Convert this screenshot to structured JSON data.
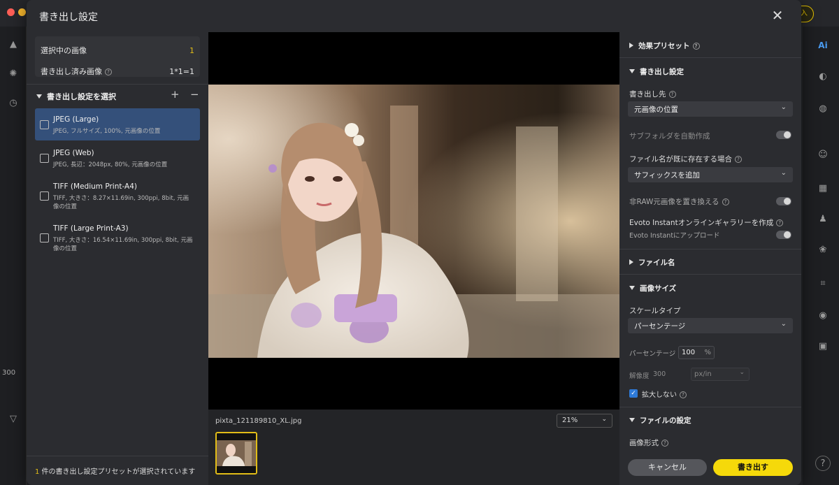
{
  "background": {
    "buy_label": "く購入",
    "left_count": "300",
    "app_logo": "Ai",
    "help": "?"
  },
  "dialog": {
    "title": "書き出し設定",
    "close": "✕"
  },
  "left": {
    "info": {
      "selected_label": "選択中の画像",
      "selected_value": "1",
      "exported_label": "書き出し済み画像",
      "exported_value": "1*1=1"
    },
    "section_title": "書き出し設定を選択",
    "add": "+",
    "remove": "−",
    "presets": [
      {
        "name": "JPEG (Large)",
        "desc": "JPEG, フルサイズ, 100%, 元画像の位置"
      },
      {
        "name": "JPEG (Web)",
        "desc": "JPEG, 長辺：2048px, 80%, 元画像の位置"
      },
      {
        "name": "TIFF (Medium Print-A4)",
        "desc": "TIFF, 大きさ：8.27×11.69in, 300ppi, 8bit, 元画像の位置"
      },
      {
        "name": "TIFF (Large Print-A3)",
        "desc": "TIFF, 大きさ：16.54×11.69in, 300ppi, 8bit, 元画像の位置"
      }
    ],
    "footer_count": "1",
    "footer_text": " 件の書き出し設定プリセットが選択されています"
  },
  "center": {
    "filename": "pixta_121189810_XL.jpg",
    "zoom": "21%"
  },
  "right": {
    "effect_preset": "効果プリセット",
    "export_settings": "書き出し設定",
    "destination_label": "書き出し先",
    "destination_value": "元画像の位置",
    "subfolder_label": "サブフォルダを自動作成",
    "exists_label": "ファイル名が既に存在する場合",
    "exists_value": "サフィックスを追加",
    "replace_raw_label": "非RAW元画像を置き換える",
    "evoto_gallery_label": "Evoto Instantオンラインギャラリーを作成",
    "evoto_upload_label": "Evoto Instantにアップロード",
    "filename_section": "ファイル名",
    "image_size_section": "画像サイズ",
    "scale_type_label": "スケールタイプ",
    "scale_type_value": "パーセンテージ",
    "percent_label": "パーセンテージ",
    "percent_value": "100",
    "percent_unit": "%",
    "resolution_label": "解像度",
    "resolution_value": "300",
    "resolution_unit": "px/in",
    "no_enlarge_label": "拡大しない",
    "file_settings_section": "ファイルの設定",
    "image_format_label": "画像形式"
  },
  "buttons": {
    "cancel": "キャンセル",
    "export": "書き出す"
  },
  "colors": {
    "accent_yellow": "#f5d90a",
    "selection_blue": "#34507a",
    "checkbox_blue": "#2e7ad8"
  }
}
